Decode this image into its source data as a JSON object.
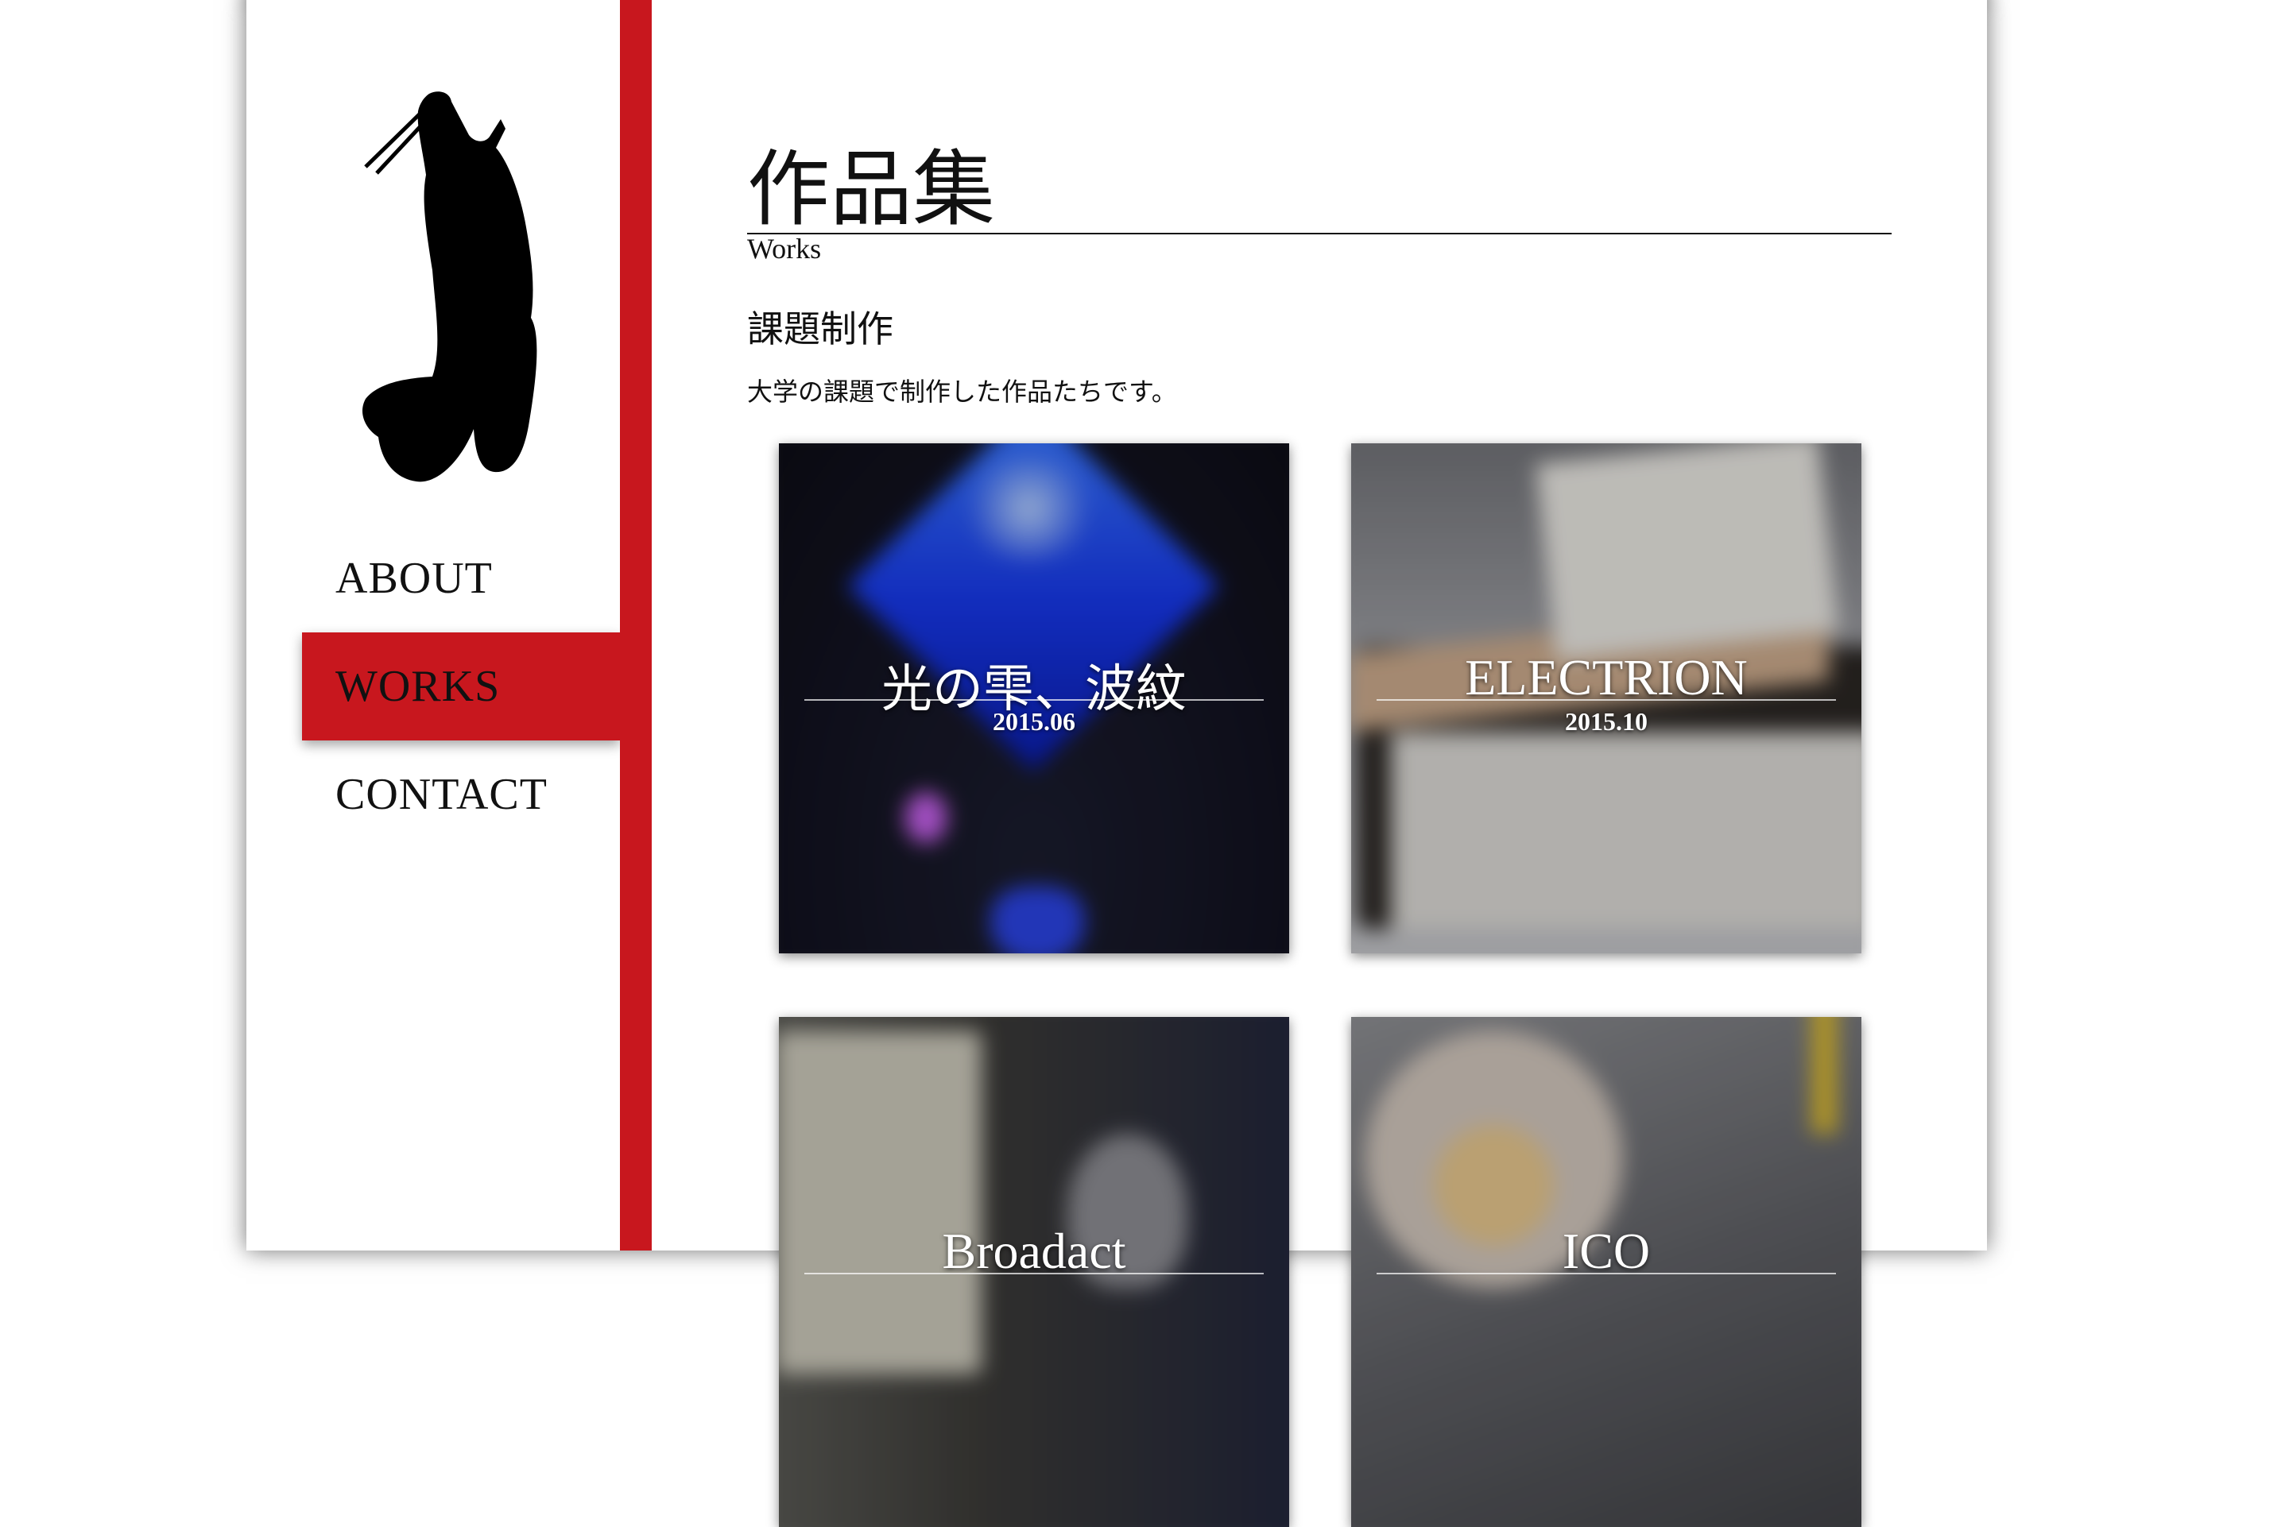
{
  "nav": {
    "items": [
      {
        "label": "ABOUT",
        "active": false
      },
      {
        "label": "WORKS",
        "active": true
      },
      {
        "label": "CONTACT",
        "active": false
      }
    ]
  },
  "header": {
    "title": "作品集",
    "subtitle": "Works"
  },
  "section": {
    "title": "課題制作",
    "description": "大学の課題で制作した作品たちです。"
  },
  "works": [
    {
      "title": "光の雫、波紋",
      "date": "2015.06"
    },
    {
      "title": "ELECTRION",
      "date": "2015.10"
    },
    {
      "title": "Broadact",
      "date": ""
    },
    {
      "title": "ICO",
      "date": ""
    }
  ],
  "colors": {
    "accent": "#c8171e",
    "background": "#ffffff",
    "text": "#111111"
  }
}
